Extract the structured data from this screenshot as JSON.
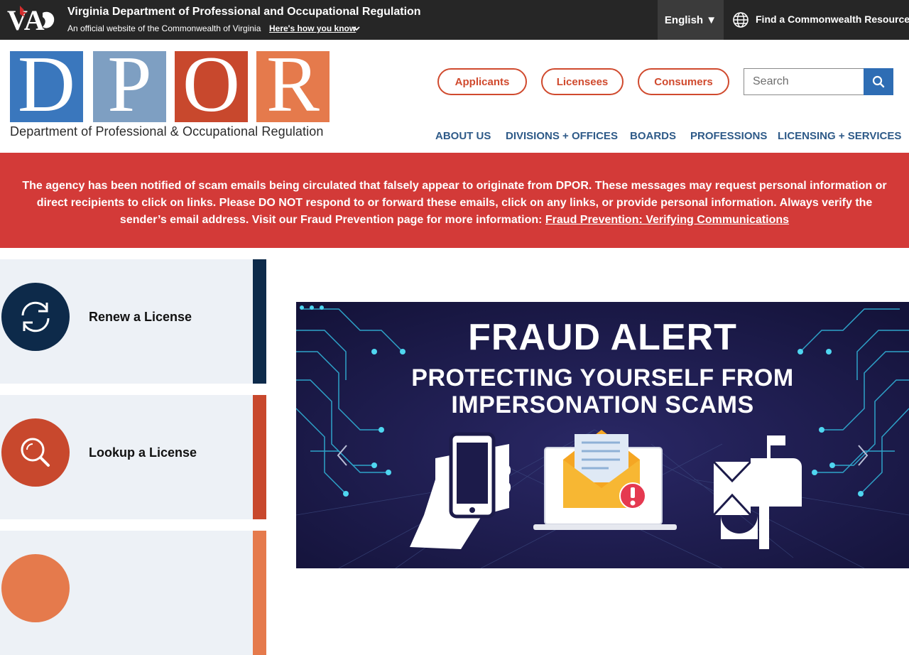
{
  "topbar": {
    "agency_name": "Virginia Department of Professional and Occupational Regulation",
    "official_text": "An official website of the Commonwealth of Virginia",
    "howto_link": "Here's how you know",
    "language": "English ▼",
    "resource_label": "Find a Commonwealth Resource"
  },
  "header": {
    "logo_letters": [
      "D",
      "P",
      "O",
      "R"
    ],
    "logo_colors": [
      "#3a77bd",
      "#7e9fc2",
      "#c8482d",
      "#e57a4c"
    ],
    "tagline": "Department of Professional & Occupational Regulation",
    "audience_buttons": [
      "Applicants",
      "Licensees",
      "Consumers"
    ],
    "search_placeholder": "Search",
    "nav": [
      "ABOUT US",
      "DIVISIONS + OFFICES",
      "BOARDS",
      "PROFESSIONS",
      "LICENSING + SERVICES"
    ]
  },
  "alert": {
    "message": "The agency has been notified of scam emails being circulated that falsely appear to originate from DPOR. These messages may request personal information or direct recipients to click on links. Please DO NOT respond to or forward these emails, click on any links, or provide personal information. Always verify the sender’s email address. Visit our Fraud Prevention page for more information: ",
    "link_text": "Fraud Prevention: Verifying Communications",
    "color": "#d33a38"
  },
  "quick_links": [
    {
      "label": "Renew a License",
      "icon": "refresh-icon",
      "color": "#0d2a4a"
    },
    {
      "label": "Lookup a License",
      "icon": "magnifier-icon",
      "color": "#c8482d"
    },
    {
      "label": "",
      "icon": "circle-icon",
      "color": "#e57a4c"
    }
  ],
  "carousel": {
    "title": "FRAUD ALERT",
    "subtitle_line1": "PROTECTING YOURSELF FROM",
    "subtitle_line2": "IMPERSONATION SCAMS",
    "slide_icons": [
      "smartphone-icon",
      "email-alert-icon",
      "mailbox-icon"
    ]
  }
}
